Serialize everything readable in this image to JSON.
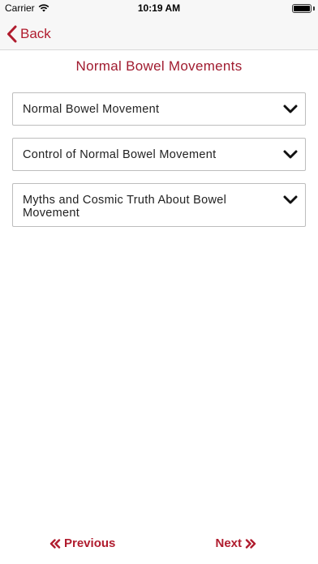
{
  "status_bar": {
    "carrier": "Carrier",
    "time": "10:19 AM",
    "battery_level": 1.0
  },
  "nav": {
    "back_label": "Back",
    "back_icon": "chevron-left-icon"
  },
  "page": {
    "title": "Normal Bowel Movements"
  },
  "accordion": [
    {
      "label": "Normal Bowel Movement",
      "icon": "chevron-down-icon"
    },
    {
      "label": "Control of Normal Bowel Movement",
      "icon": "chevron-down-icon"
    },
    {
      "label": "Myths and Cosmic Truth About Bowel Movement",
      "icon": "chevron-down-icon"
    }
  ],
  "footer": {
    "previous_label": "Previous",
    "next_label": "Next",
    "previous_icon": "double-chevron-left-icon",
    "next_icon": "double-chevron-right-icon"
  },
  "colors": {
    "accent": "#b01c2e",
    "title": "#a01b2f",
    "bar_background": "#f7f7f7",
    "border": "#bdbdbd"
  }
}
